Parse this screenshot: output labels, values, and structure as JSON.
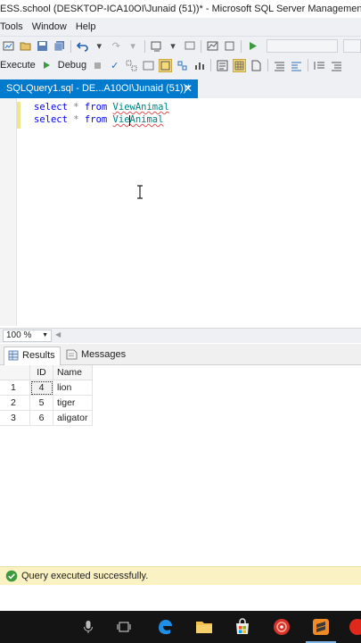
{
  "window": {
    "title": "ESS.school (DESKTOP-ICA10OI\\Junaid (51))* - Microsoft SQL Server Management Studio"
  },
  "menubar": {
    "items": [
      "Tools",
      "Window",
      "Help"
    ]
  },
  "toolbar": {
    "execute_label": "Execute",
    "debug_label": "Debug"
  },
  "document_tab": {
    "label": "SQLQuery1.sql - DE...A10OI\\Junaid (51))*",
    "close_glyph": "✕"
  },
  "editor": {
    "lines": [
      {
        "keyword1": "select",
        "operator": "*",
        "keyword2": "from",
        "object": "ViewAnimal"
      },
      {
        "keyword1": "select",
        "operator": "*",
        "keyword2": "from",
        "object": "VieAnimal"
      }
    ]
  },
  "zoom": {
    "value": "100 %"
  },
  "results_tabs": {
    "results_label": "Results",
    "messages_label": "Messages"
  },
  "results": {
    "columns": [
      "ID",
      "Name"
    ],
    "rows": [
      {
        "row": "1",
        "id": "4",
        "name": "lion"
      },
      {
        "row": "2",
        "id": "5",
        "name": "tiger"
      },
      {
        "row": "3",
        "id": "6",
        "name": "aligator"
      }
    ]
  },
  "status": {
    "message": "Query executed successfully."
  },
  "icons": {
    "status": "success-check-icon",
    "taskbar": [
      "microphone-icon",
      "task-view-icon",
      "edge-icon",
      "file-explorer-icon",
      "store-icon",
      "media-icon",
      "sublime-icon",
      "app-icon"
    ]
  },
  "colors": {
    "accent": "#007acc",
    "status_bg": "#fbf2c4",
    "keyword": "#0000ff",
    "object": "#008080"
  }
}
